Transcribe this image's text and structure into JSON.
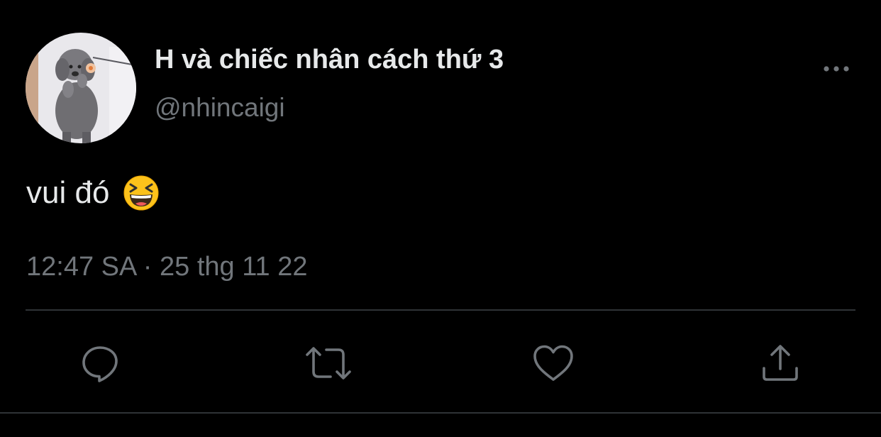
{
  "tweet": {
    "display_name": "H và chiếc nhân cách thứ 3",
    "handle": "@nhincaigi",
    "text": "vui đó",
    "emoji": "laughing-face-emoji",
    "timestamp": "12:47 SA · 25 thg 11 22"
  },
  "icons": {
    "more": "more-horizontal-icon",
    "reply": "reply-icon",
    "retweet": "retweet-icon",
    "like": "heart-icon",
    "share": "share-icon"
  },
  "colors": {
    "background": "#000000",
    "primary_text": "#e7e9ea",
    "secondary_text": "#71767b",
    "divider": "#2f3336"
  }
}
